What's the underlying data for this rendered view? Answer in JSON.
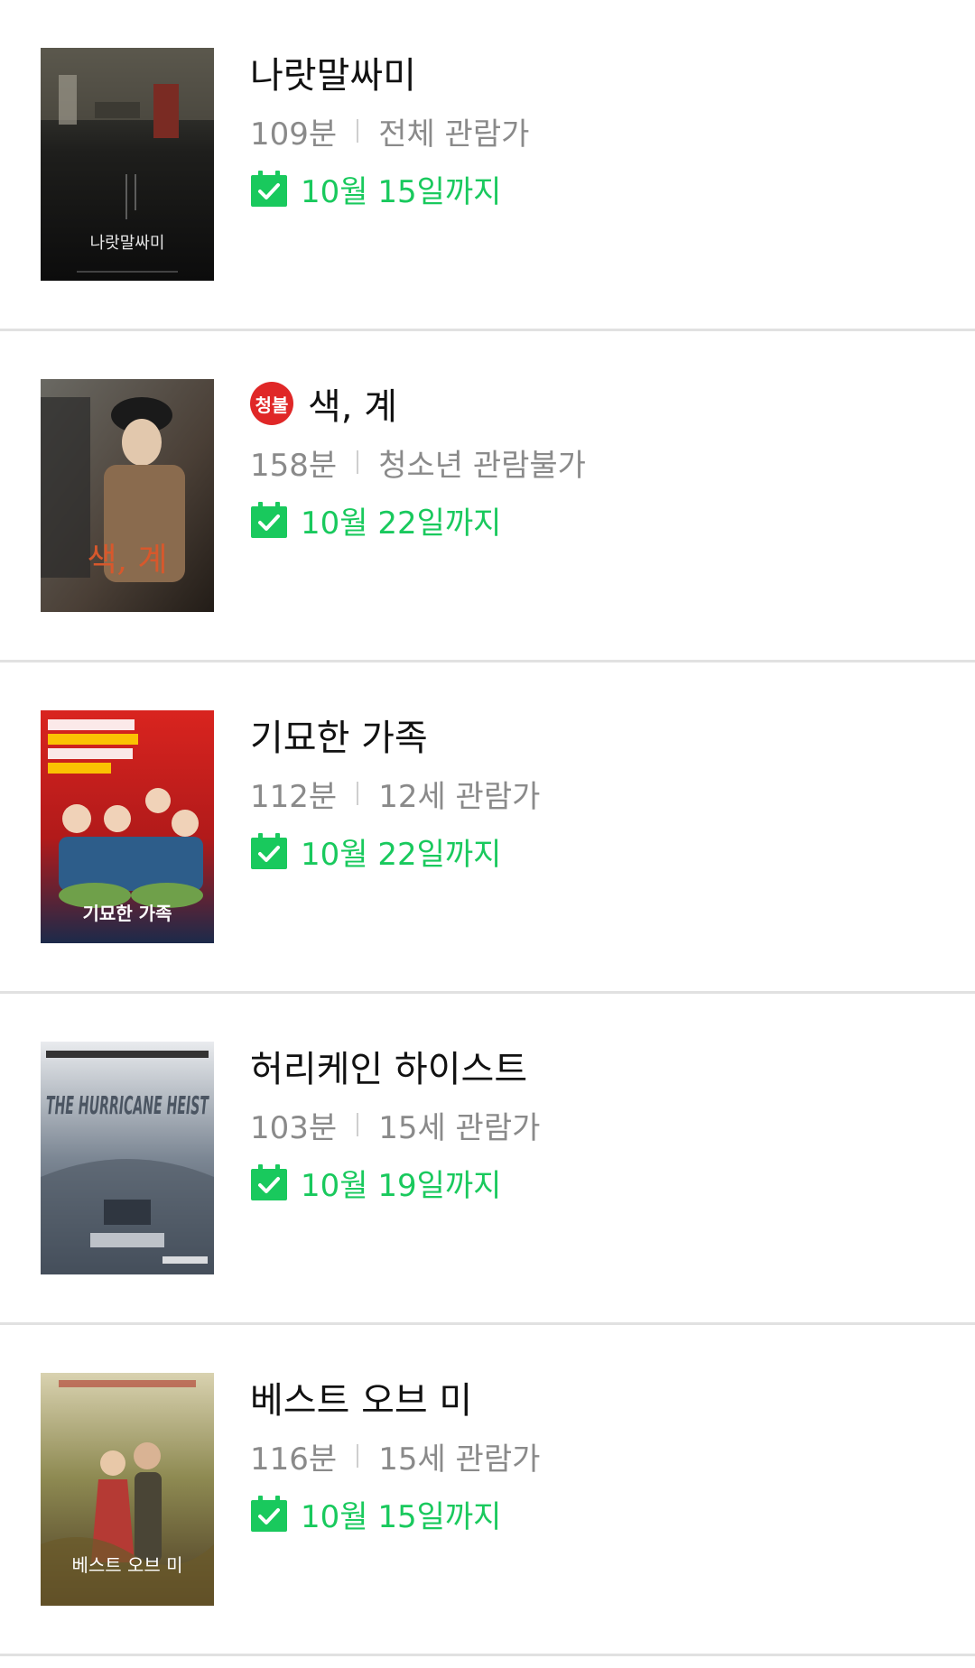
{
  "movies": [
    {
      "title": "나랏말싸미",
      "runtime": "109분",
      "rating": "전체 관람가",
      "until": "10월 15일까지",
      "poster_icon": "poster-image",
      "poster_text": "나랏말싸미"
    },
    {
      "title": "색, 계",
      "badge": "청불",
      "runtime": "158분",
      "rating": "청소년 관람불가",
      "until": "10월 22일까지",
      "poster_icon": "poster-image",
      "poster_text": "색, 계"
    },
    {
      "title": "기묘한 가족",
      "runtime": "112분",
      "rating": "12세 관람가",
      "until": "10월 22일까지",
      "poster_icon": "poster-image",
      "poster_text": "기묘한 가족"
    },
    {
      "title": "허리케인 하이스트",
      "runtime": "103분",
      "rating": "15세 관람가",
      "until": "10월 19일까지",
      "poster_icon": "poster-image",
      "poster_text": "THE HURRICANE HEIST"
    },
    {
      "title": "베스트 오브 미",
      "runtime": "116분",
      "rating": "15세 관람가",
      "until": "10월 15일까지",
      "poster_icon": "poster-image",
      "poster_text": "베스트 오브 미"
    }
  ],
  "colors": {
    "accent_green": "#19c95d",
    "badge_red": "#e02727",
    "divider": "#e1e1e1",
    "meta_gray": "#8a8a8a"
  },
  "icons": {
    "calendar": "calendar-check-icon",
    "badge": "adult-rating-badge"
  }
}
